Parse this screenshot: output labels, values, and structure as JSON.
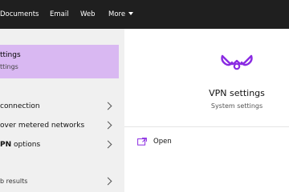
{
  "topbar": {
    "tabs": [
      {
        "label": "Documents"
      },
      {
        "label": "Email"
      },
      {
        "label": "Web"
      },
      {
        "label": "More"
      }
    ]
  },
  "best_match": {
    "title": "ttings",
    "subtitle": "ttings"
  },
  "results": [
    {
      "label": "connection"
    },
    {
      "label": "over metered networks"
    },
    {
      "label_bold": "PN",
      "label_rest": " options"
    },
    {
      "label": "b results"
    }
  ],
  "preview": {
    "title": "VPN settings",
    "subtitle": "System settings",
    "action_open": "Open"
  },
  "colors": {
    "topbar_bg": "#1f1f1f",
    "highlight": "#d9b8f2",
    "accent": "#8a2be2",
    "left_bg": "#f0f0f0"
  },
  "icons": {
    "vpn": "vpn-icon",
    "open": "open-icon",
    "chevron": "chevron-right-icon",
    "more": "chevron-down-icon"
  }
}
